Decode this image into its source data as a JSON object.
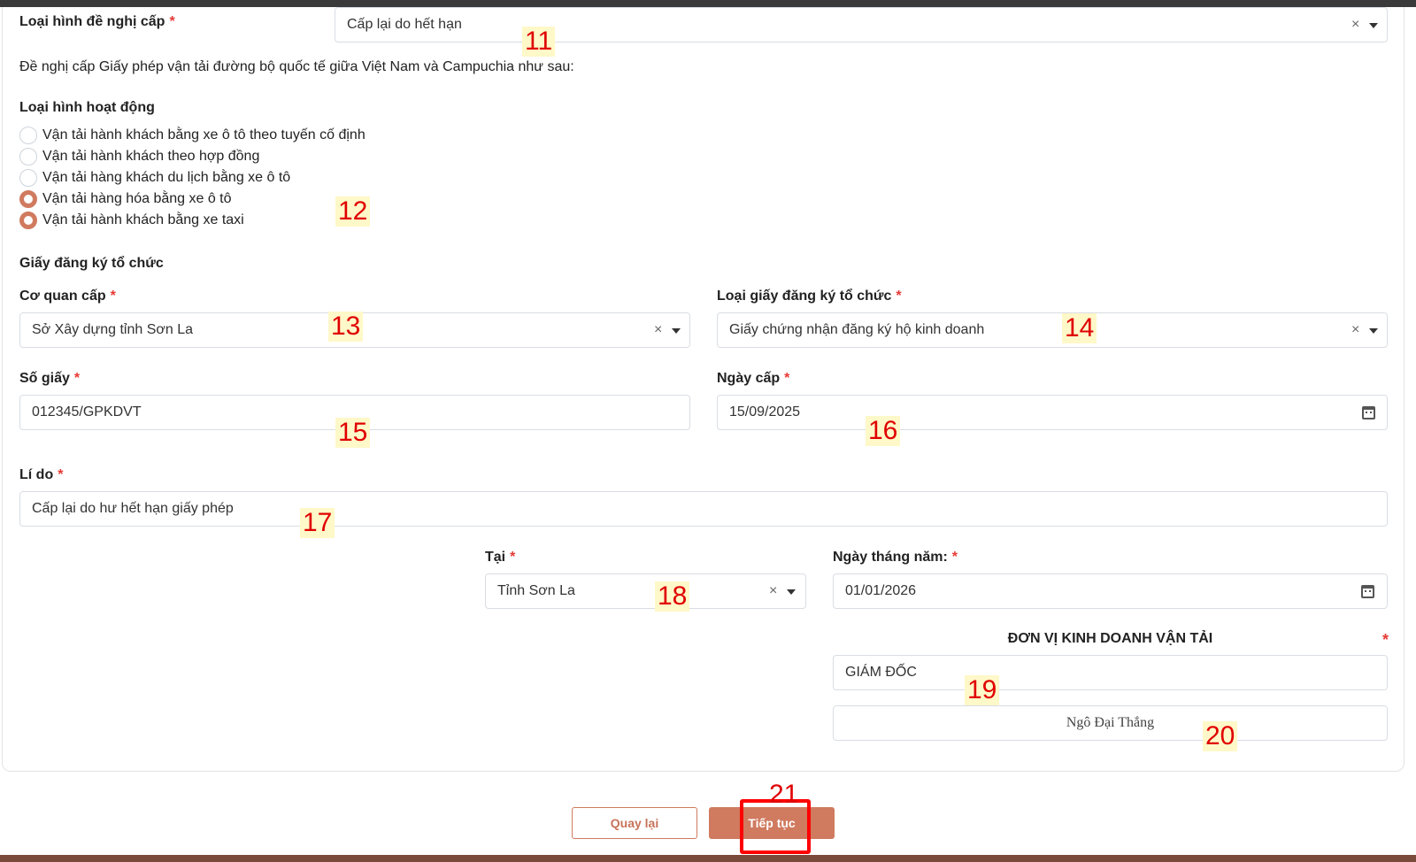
{
  "form": {
    "loai_hinh_de_nghi": {
      "label": "Loại hình đề nghị cấp",
      "required_mark": "*",
      "value": "Cấp lại do hết hạn",
      "clear": "×"
    },
    "intro_text": "Đề nghị cấp Giấy phép vận tải đường bộ quốc tế giữa Việt Nam và Campuchia như sau:",
    "loai_hinh_hoat_dong": {
      "label": "Loại hình hoạt động",
      "options": [
        {
          "label": "Vận tải hành khách bằng xe ô tô theo tuyến cố định",
          "checked": false
        },
        {
          "label": "Vận tải hành khách theo hợp đồng",
          "checked": false
        },
        {
          "label": "Vận tải hàng khách du lịch bằng xe ô tô",
          "checked": false
        },
        {
          "label": "Vận tải hàng hóa bằng xe ô tô",
          "checked": true
        },
        {
          "label": "Vận tải hành khách bằng xe taxi",
          "checked": true
        }
      ]
    },
    "giay_dang_ky_heading": "Giấy đăng ký tổ chức",
    "co_quan_cap": {
      "label": "Cơ quan cấp",
      "required_mark": "*",
      "value": "Sở Xây dựng tỉnh Sơn La",
      "clear": "×"
    },
    "loai_giay": {
      "label": "Loại giấy đăng ký tổ chức",
      "required_mark": "*",
      "value": "Giấy chứng nhận đăng ký hộ kinh doanh",
      "clear": "×"
    },
    "so_giay": {
      "label": "Số giấy",
      "required_mark": "*",
      "value": "012345/GPKDVT"
    },
    "ngay_cap": {
      "label": "Ngày cấp",
      "required_mark": "*",
      "value": "15/09/2025"
    },
    "li_do": {
      "label": "Lí do",
      "required_mark": "*",
      "value": "Cấp lại do hư hết hạn giấy phép"
    },
    "tai": {
      "label": "Tại",
      "required_mark": "*",
      "value": "Tỉnh Sơn La",
      "clear": "×"
    },
    "ngay_thang_nam": {
      "label": "Ngày tháng năm:",
      "required_mark": "*",
      "value": "01/01/2026"
    },
    "signature": {
      "heading": "ĐƠN VỊ KINH DOANH VẬN TẢI",
      "required_mark": "*",
      "title_value": "GIÁM ĐỐC",
      "name_value": "Ngô Đại Thắng"
    }
  },
  "actions": {
    "back_label": "Quay lại",
    "next_label": "Tiếp tục"
  },
  "callouts": [
    "11",
    "12",
    "13",
    "14",
    "15",
    "16",
    "17",
    "18",
    "19",
    "20",
    "21"
  ],
  "colors": {
    "accent": "#d07a5f",
    "required": "#e53935",
    "callout_text": "#e00000",
    "callout_bg": "#fff8c8",
    "highlight": "#ff0000"
  }
}
